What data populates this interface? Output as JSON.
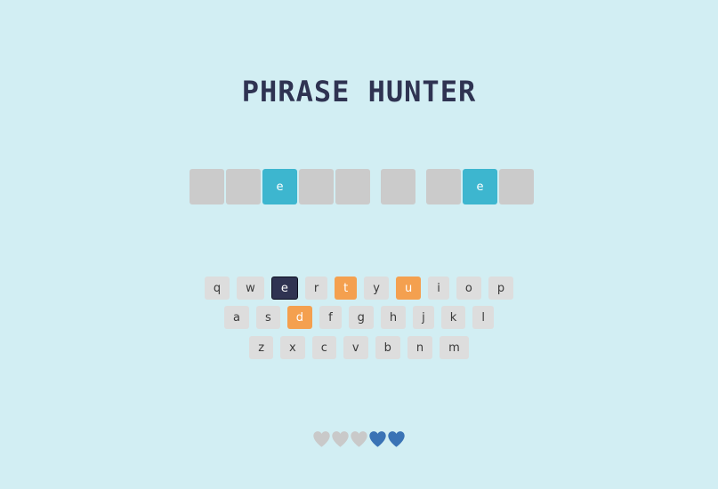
{
  "title": "PHRASE HUNTER",
  "phrase": [
    {
      "type": "tile",
      "letter": "",
      "revealed": false
    },
    {
      "type": "tile",
      "letter": "",
      "revealed": false
    },
    {
      "type": "tile",
      "letter": "e",
      "revealed": true
    },
    {
      "type": "tile",
      "letter": "",
      "revealed": false
    },
    {
      "type": "tile",
      "letter": "",
      "revealed": false
    },
    {
      "type": "space"
    },
    {
      "type": "tile",
      "letter": "",
      "revealed": false
    },
    {
      "type": "space"
    },
    {
      "type": "tile",
      "letter": "",
      "revealed": false
    },
    {
      "type": "tile",
      "letter": "e",
      "revealed": true
    },
    {
      "type": "tile",
      "letter": "",
      "revealed": false
    }
  ],
  "keyboard": {
    "rows": [
      [
        {
          "key": "q",
          "state": "default"
        },
        {
          "key": "w",
          "state": "default"
        },
        {
          "key": "e",
          "state": "chosen"
        },
        {
          "key": "r",
          "state": "default"
        },
        {
          "key": "t",
          "state": "wrong"
        },
        {
          "key": "y",
          "state": "default"
        },
        {
          "key": "u",
          "state": "wrong"
        },
        {
          "key": "i",
          "state": "default"
        },
        {
          "key": "o",
          "state": "default"
        },
        {
          "key": "p",
          "state": "default"
        }
      ],
      [
        {
          "key": "a",
          "state": "default"
        },
        {
          "key": "s",
          "state": "default"
        },
        {
          "key": "d",
          "state": "wrong"
        },
        {
          "key": "f",
          "state": "default"
        },
        {
          "key": "g",
          "state": "default"
        },
        {
          "key": "h",
          "state": "default"
        },
        {
          "key": "j",
          "state": "default"
        },
        {
          "key": "k",
          "state": "default"
        },
        {
          "key": "l",
          "state": "default"
        }
      ],
      [
        {
          "key": "z",
          "state": "default"
        },
        {
          "key": "x",
          "state": "default"
        },
        {
          "key": "c",
          "state": "default"
        },
        {
          "key": "v",
          "state": "default"
        },
        {
          "key": "b",
          "state": "default"
        },
        {
          "key": "n",
          "state": "default"
        },
        {
          "key": "m",
          "state": "default"
        }
      ]
    ]
  },
  "lives": {
    "total": 5,
    "remaining": 2,
    "icon": "heart-icon",
    "colors": {
      "live": "#3a73b5",
      "lost": "#c9c9c9"
    }
  },
  "colors": {
    "background": "#d2eef3",
    "title": "#2f3352",
    "tile_hidden": "#cbcbcb",
    "tile_revealed": "#3db6cf",
    "key_default": "#dddddd",
    "key_chosen": "#2f3352",
    "key_wrong": "#f4a04f"
  }
}
